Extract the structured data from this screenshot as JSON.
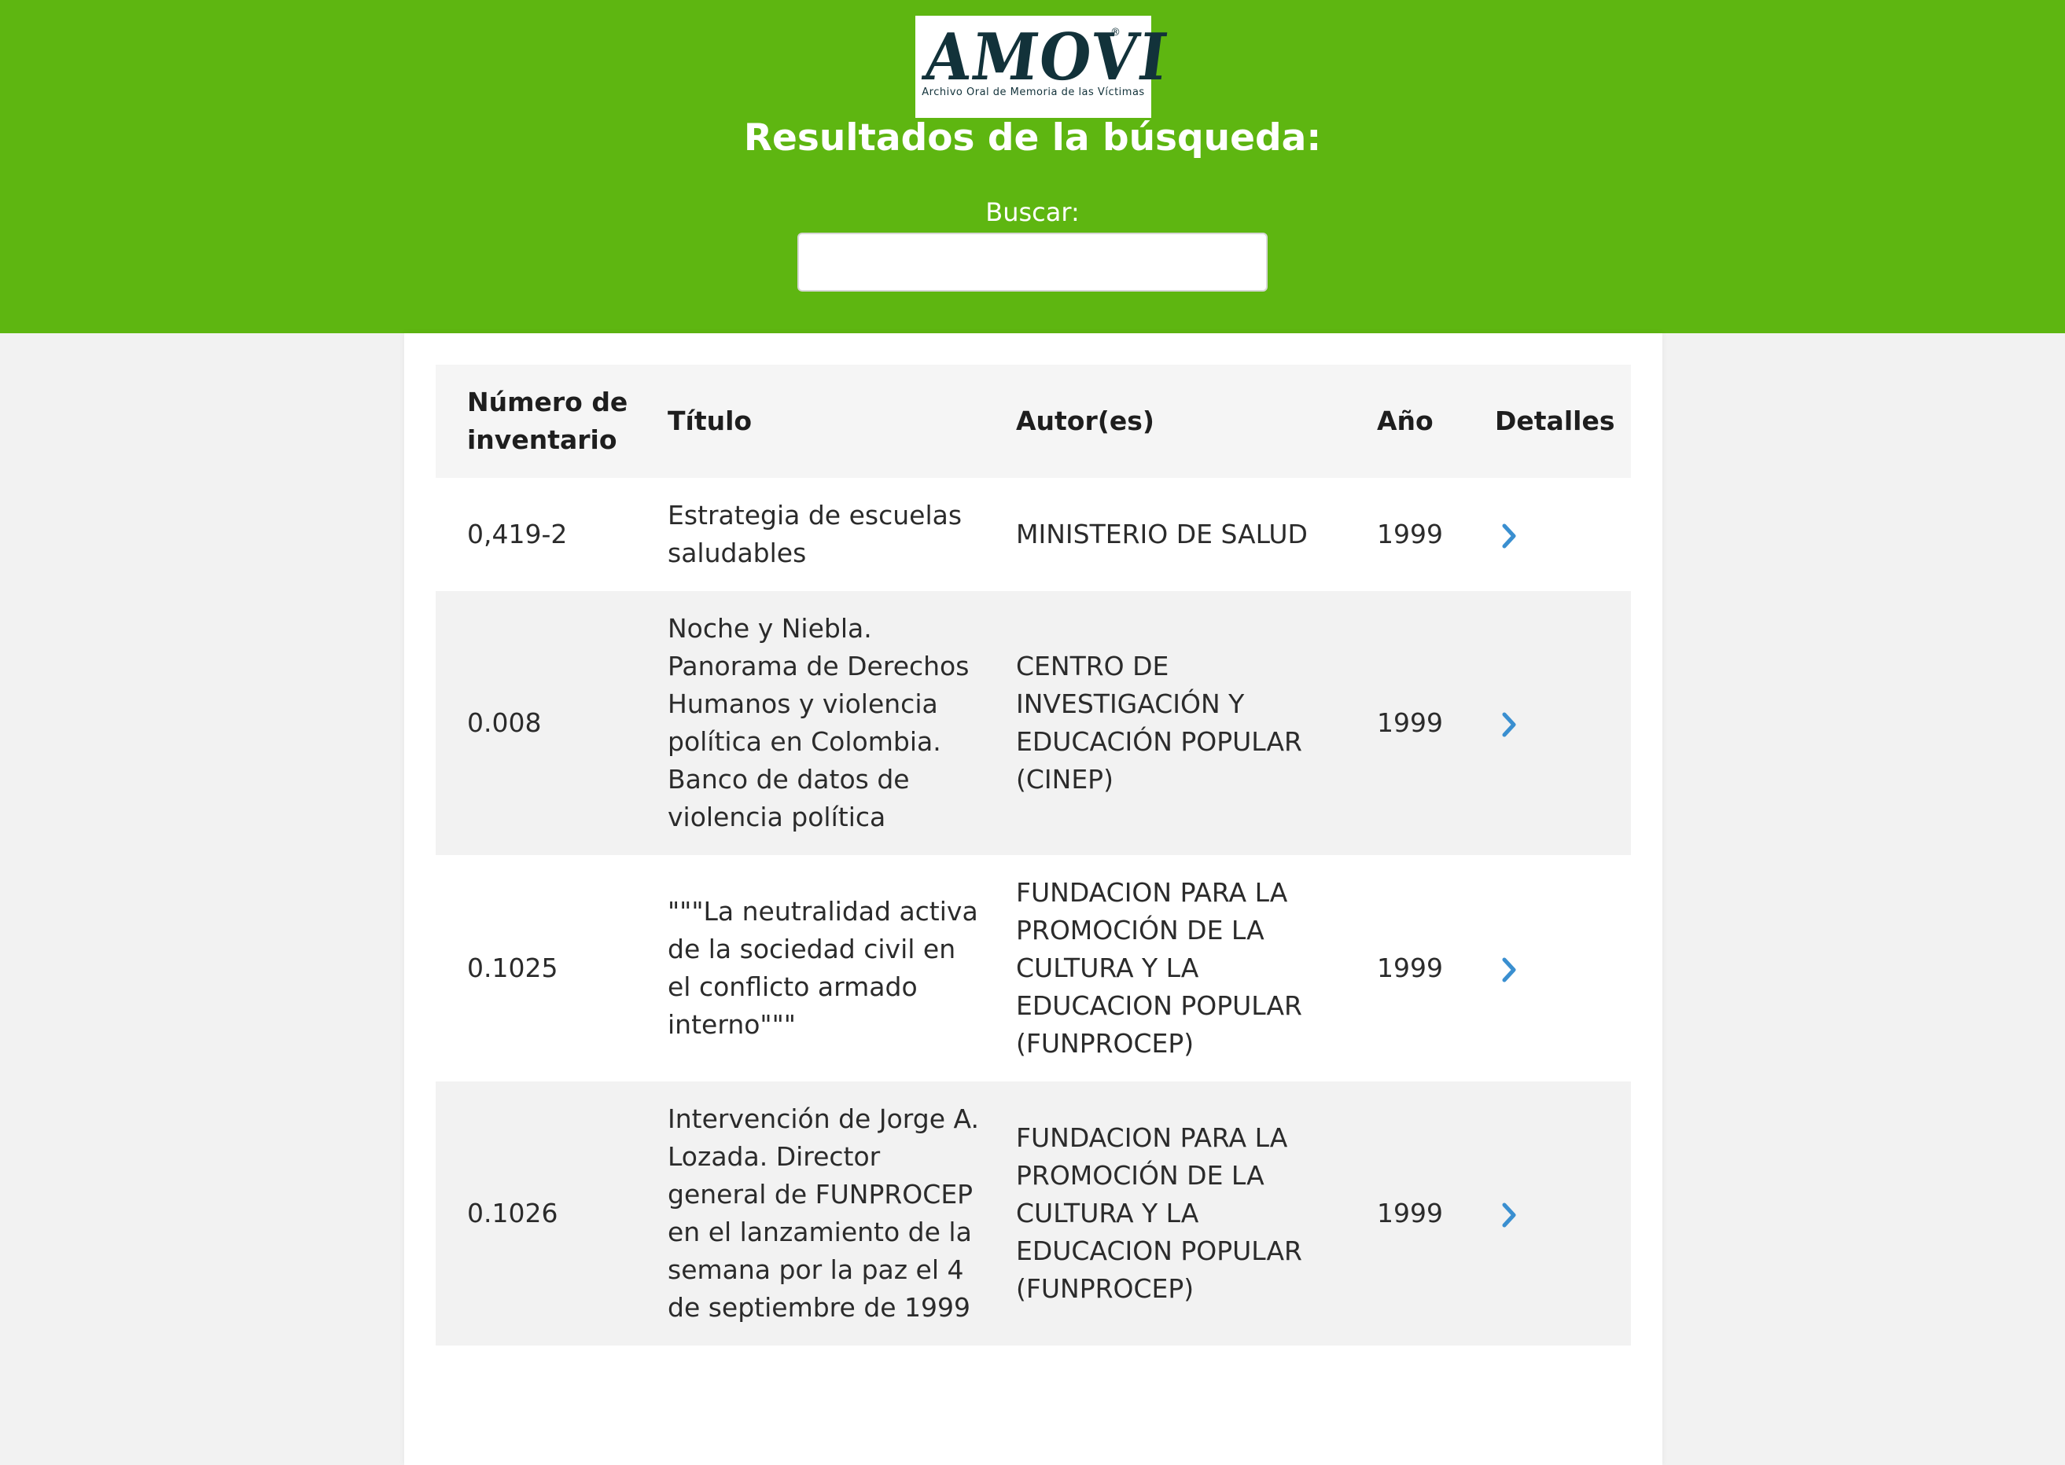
{
  "header": {
    "logo": {
      "word": "AMOVI",
      "subtitle": "Archivo Oral de Memoria de las Víctimas",
      "registered_mark": "®"
    },
    "title": "Resultados de la búsqueda:",
    "search": {
      "label": "Buscar:",
      "value": "",
      "placeholder": ""
    }
  },
  "colors": {
    "header_bg": "#5eb611",
    "chevron": "#3a8fd0",
    "logo_text": "#12323a"
  },
  "table": {
    "columns": [
      "Número de inventario",
      "Título",
      "Autor(es)",
      "Año",
      "Detalles"
    ],
    "rows": [
      {
        "numero": "0,419-2",
        "titulo": "Estrategia de escuelas saludables",
        "autor": "MINISTERIO DE SALUD",
        "anio": "1999",
        "detalles_icon": "chevron-right-icon"
      },
      {
        "numero": "0.008",
        "titulo": "Noche y Niebla. Panorama de Derechos Humanos y violencia política en Colombia. Banco de datos de violencia política",
        "autor": "CENTRO DE INVESTIGACIÓN Y EDUCACIÓN POPULAR (CINEP)",
        "anio": "1999",
        "detalles_icon": "chevron-right-icon"
      },
      {
        "numero": "0.1025",
        "titulo": "\"\"\"La neutralidad activa de la sociedad civil en el conflicto armado interno\"\"\"",
        "autor": "FUNDACION PARA LA PROMOCIÓN DE LA CULTURA Y LA EDUCACION POPULAR (FUNPROCEP)",
        "anio": "1999",
        "detalles_icon": "chevron-right-icon"
      },
      {
        "numero": "0.1026",
        "titulo": "Intervención de Jorge A. Lozada. Director general de FUNPROCEP en el lanzamiento de la semana por la paz el 4 de septiembre de 1999",
        "autor": "FUNDACION PARA LA PROMOCIÓN DE LA CULTURA Y LA EDUCACION POPULAR (FUNPROCEP)",
        "anio": "1999",
        "detalles_icon": "chevron-right-icon"
      }
    ]
  }
}
